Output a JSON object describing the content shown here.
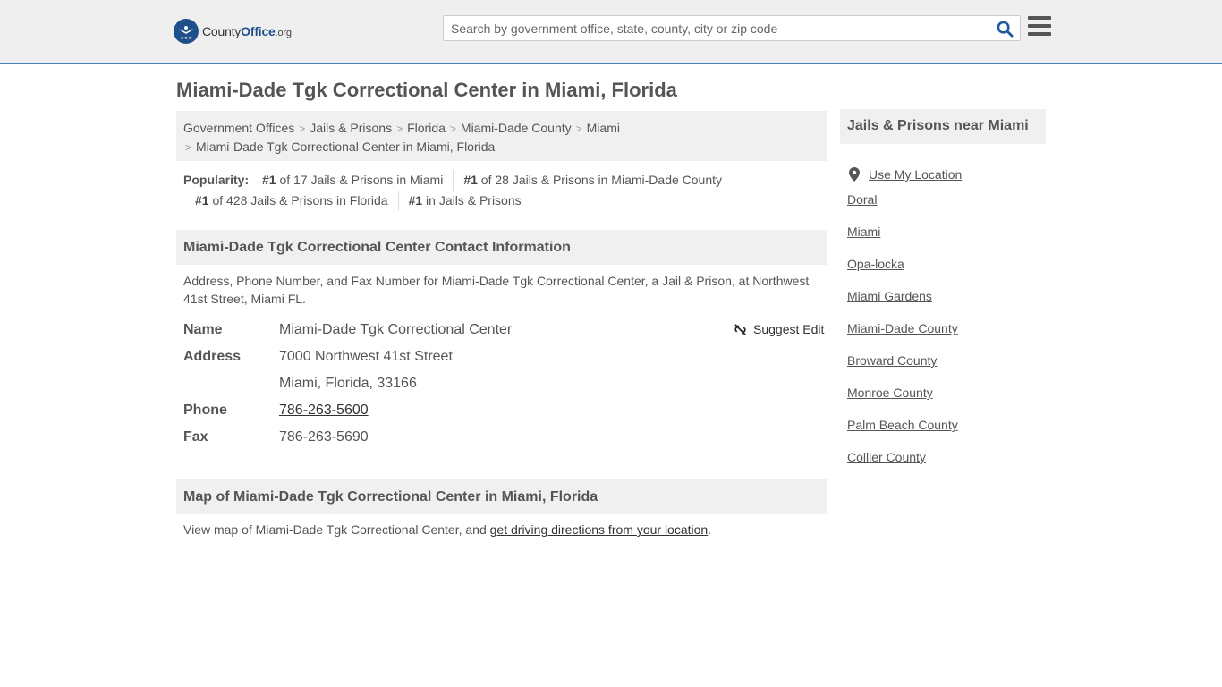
{
  "header": {
    "logo_county": "County",
    "logo_office": "Office",
    "logo_tld": ".org",
    "search_placeholder": "Search by government office, state, county, city or zip code"
  },
  "page": {
    "title": "Miami-Dade Tgk Correctional Center in Miami, Florida"
  },
  "breadcrumb": {
    "items": [
      "Government Offices",
      "Jails & Prisons",
      "Florida",
      "Miami-Dade County",
      "Miami"
    ],
    "current": "Miami-Dade Tgk Correctional Center in Miami, Florida"
  },
  "popularity": {
    "label": "Popularity:",
    "items": [
      {
        "rank": "#1",
        "text": " of 17 Jails & Prisons in Miami"
      },
      {
        "rank": "#1",
        "text": " of 28 Jails & Prisons in Miami-Dade County"
      },
      {
        "rank": "#1",
        "text": " of 428 Jails & Prisons in Florida"
      },
      {
        "rank": "#1",
        "text": " in Jails & Prisons"
      }
    ]
  },
  "contact": {
    "heading": "Miami-Dade Tgk Correctional Center Contact Information",
    "description": "Address, Phone Number, and Fax Number for Miami-Dade Tgk Correctional Center, a Jail & Prison, at Northwest 41st Street, Miami FL.",
    "suggest_edit": "Suggest Edit",
    "name_label": "Name",
    "name": "Miami-Dade Tgk Correctional Center",
    "address_label": "Address",
    "address_line1": "7000 Northwest 41st Street",
    "address_line2": "Miami, Florida, 33166",
    "phone_label": "Phone",
    "phone": "786-263-5600",
    "fax_label": "Fax",
    "fax": "786-263-5690"
  },
  "map": {
    "heading": "Map of Miami-Dade Tgk Correctional Center in Miami, Florida",
    "desc_prefix": "View map of Miami-Dade Tgk Correctional Center, and ",
    "desc_link": "get driving directions from your location",
    "desc_suffix": "."
  },
  "sidebar": {
    "heading": "Jails & Prisons near Miami",
    "use_location": "Use My Location",
    "items": [
      "Doral",
      "Miami",
      "Opa-locka",
      "Miami Gardens",
      "Miami-Dade County",
      "Broward County",
      "Monroe County",
      "Palm Beach County",
      "Collier County"
    ]
  }
}
